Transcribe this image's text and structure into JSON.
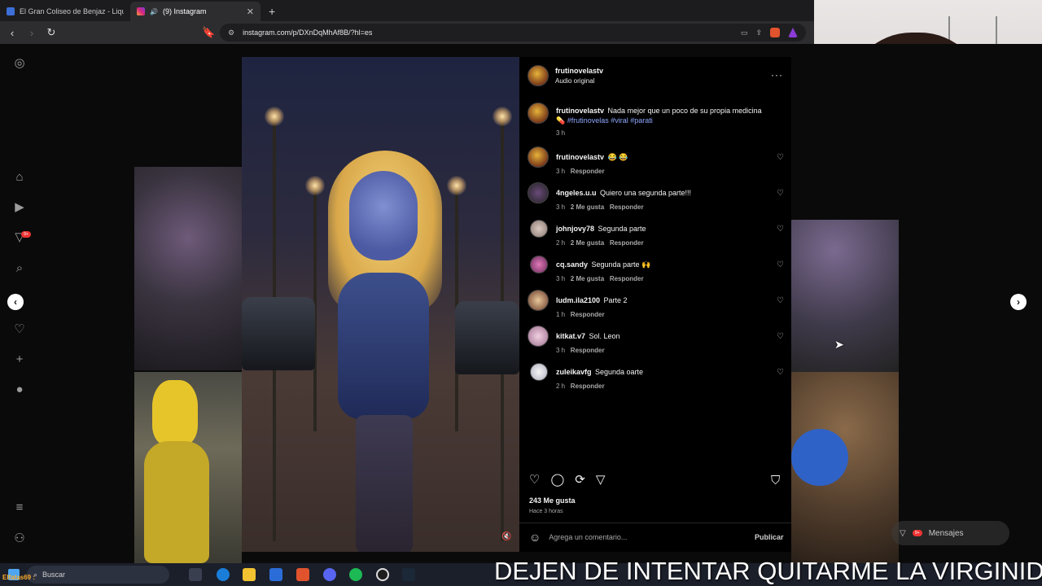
{
  "browser": {
    "tabs": [
      {
        "label": "El Gran Coliseo de Benjaz - Liquipedia",
        "active": false
      },
      {
        "label": "(9) Instagram",
        "active": true
      }
    ],
    "new_tab": "+",
    "url": "instagram.com/p/DXnDqMhAf8B/?hl=es"
  },
  "sidenav": {
    "notifications_badge": "9+"
  },
  "post": {
    "author": "frutinovelastv",
    "audio": "Audio original",
    "caption_user": "frutinovelastv",
    "caption_text": "Nada mejor que un poco de su propia medicina",
    "caption_tags": "💊 #frutinovelas #viral #parati",
    "caption_time": "3 h",
    "likes": "243 Me gusta",
    "posted_ago": "Hace 3 horas",
    "comment_placeholder": "Agrega un comentario...",
    "publish_label": "Publicar"
  },
  "comments": [
    {
      "user": "frutinovelastv",
      "text": "😂 😂",
      "time": "3 h",
      "likes": "",
      "reply": "Responder"
    },
    {
      "user": "4ngeles.u.u",
      "text": "Quiero una segunda parte!!!",
      "time": "3 h",
      "likes": "2 Me gusta",
      "reply": "Responder"
    },
    {
      "user": "johnjovy78",
      "text": "Segunda parte",
      "time": "2 h",
      "likes": "2 Me gusta",
      "reply": "Responder"
    },
    {
      "user": "cq.sandy",
      "text": "Segunda parte 🙌",
      "time": "3 h",
      "likes": "2 Me gusta",
      "reply": "Responder"
    },
    {
      "user": "ludm.ila2100",
      "text": "Parte 2",
      "time": "1 h",
      "likes": "",
      "reply": "Responder"
    },
    {
      "user": "kitkat.v7",
      "text": "Sol. Leon",
      "time": "3 h",
      "likes": "",
      "reply": "Responder"
    },
    {
      "user": "zuleikavfg",
      "text": "Segunda oarte",
      "time": "2 h",
      "likes": "",
      "reply": "Responder"
    }
  ],
  "messages": {
    "label": "Mensajes",
    "badge": "9+"
  },
  "taskbar": {
    "search_placeholder": "Buscar",
    "chat_user": "Elfatas69 :"
  },
  "stream_overlay": {
    "text": "DEJEN DE INTENTAR QUITARME LA VIRGINIDAD"
  },
  "icons": [
    "instagram-icon",
    "home-icon",
    "reels-icon",
    "notifications-icon",
    "search-icon",
    "heart-icon",
    "plus-icon",
    "profile-icon",
    "menu-icon",
    "threads-icon"
  ],
  "colors": {
    "accent_link": "#8fa8ff",
    "background": "#000000",
    "overlay_text": "#ffffff"
  }
}
